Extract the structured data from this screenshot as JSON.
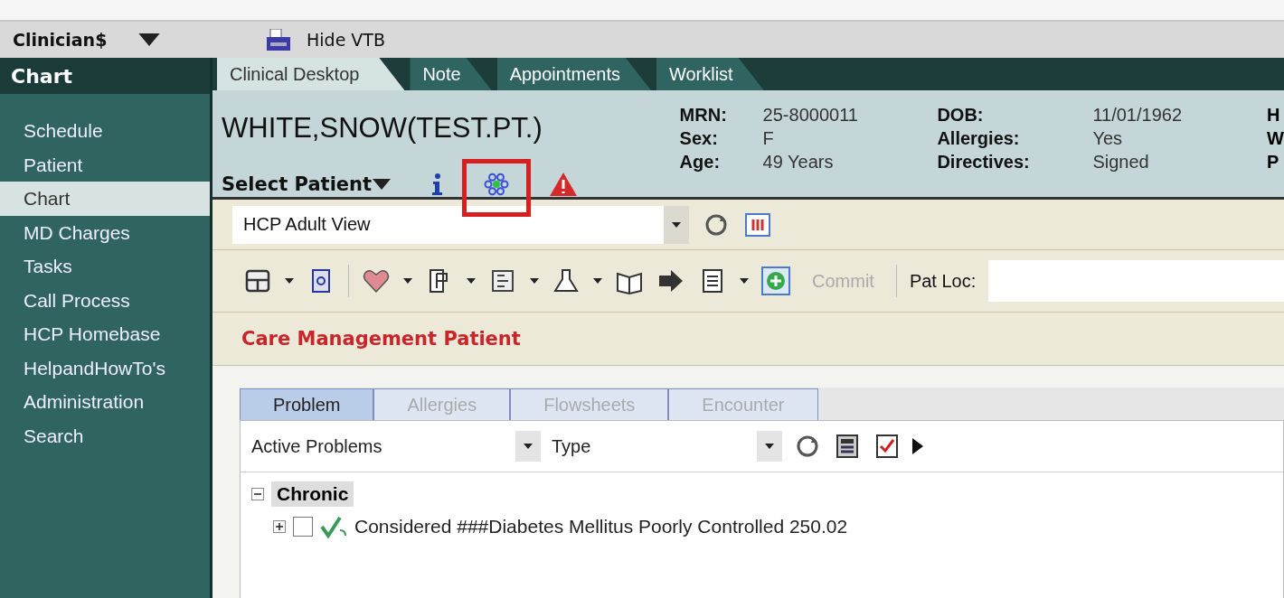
{
  "top_bar": {
    "user": "Clinician$",
    "hide_button": "Hide VTB"
  },
  "sidebar": {
    "title": "Chart",
    "items": [
      {
        "label": "Schedule",
        "selected": false
      },
      {
        "label": "Patient",
        "selected": false
      },
      {
        "label": "Chart",
        "selected": true
      },
      {
        "label": "MD Charges",
        "selected": false
      },
      {
        "label": "Tasks",
        "selected": false
      },
      {
        "label": "Call Process",
        "selected": false
      },
      {
        "label": "HCP Homebase",
        "selected": false
      },
      {
        "label": "HelpandHowTo's",
        "selected": false
      },
      {
        "label": "Administration",
        "selected": false
      },
      {
        "label": "Search",
        "selected": false
      }
    ]
  },
  "tabs": [
    {
      "label": "Clinical Desktop",
      "selected": true
    },
    {
      "label": "Note",
      "selected": false
    },
    {
      "label": "Appointments",
      "selected": false
    },
    {
      "label": "Worklist",
      "selected": false
    }
  ],
  "patient": {
    "name": "WHITE,SNOW(TEST.PT.)",
    "select_label": "Select Patient",
    "columns": [
      [
        {
          "label": "MRN:",
          "value": "25-8000011"
        },
        {
          "label": "Sex:",
          "value": "F"
        },
        {
          "label": "Age:",
          "value": "49 Years"
        }
      ],
      [
        {
          "label": "DOB:",
          "value": "11/01/1962"
        },
        {
          "label": "Allergies:",
          "value": "Yes"
        },
        {
          "label": "Directives:",
          "value": "Signed"
        }
      ]
    ],
    "cut_labels": [
      "H",
      "W",
      "P"
    ]
  },
  "view": {
    "value": "HCP Adult View"
  },
  "toolbar": {
    "commit": "Commit",
    "commit_disabled": true,
    "pat_loc_label": "Pat Loc:"
  },
  "banner": "Care Management Patient",
  "subtabs": [
    {
      "label": "Problem",
      "selected": true
    },
    {
      "label": "Allergies",
      "selected": false
    },
    {
      "label": "Flowsheets",
      "selected": false
    },
    {
      "label": "Encounter",
      "selected": false
    }
  ],
  "filters": [
    {
      "value": "Active Problems"
    },
    {
      "value": "Type"
    }
  ],
  "tree": [
    {
      "label": "Chronic",
      "expanded": true,
      "children": [
        {
          "label": "Considered ###Diabetes Mellitus Poorly Controlled 250.02",
          "expanded": false,
          "checked": false
        }
      ]
    }
  ]
}
